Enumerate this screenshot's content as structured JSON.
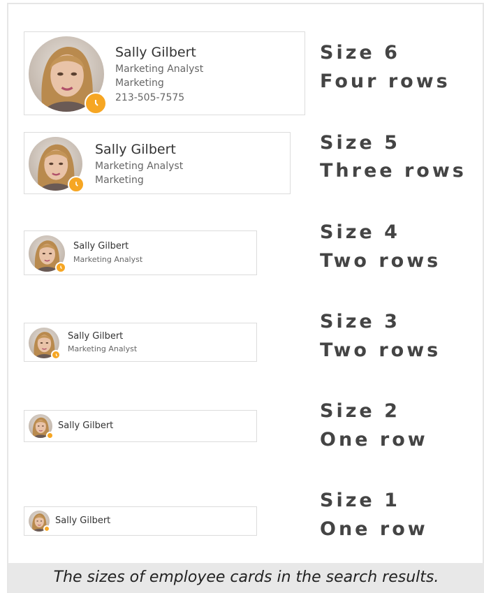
{
  "employee": {
    "name": "Sally Gilbert",
    "title": "Marketing Analyst",
    "department": "Marketing",
    "phone": "213-505-7575",
    "presence_icon": "clock-icon",
    "presence_color": "#f6a623"
  },
  "sizes": [
    {
      "label": "Size 6",
      "rows": "Four rows"
    },
    {
      "label": "Size 5",
      "rows": "Three rows"
    },
    {
      "label": "Size 4",
      "rows": "Two rows"
    },
    {
      "label": "Size 3",
      "rows": "Two rows"
    },
    {
      "label": "Size 2",
      "rows": "One row"
    },
    {
      "label": "Size 1",
      "rows": "One row"
    }
  ],
  "caption": "The sizes of employee cards in the search results."
}
